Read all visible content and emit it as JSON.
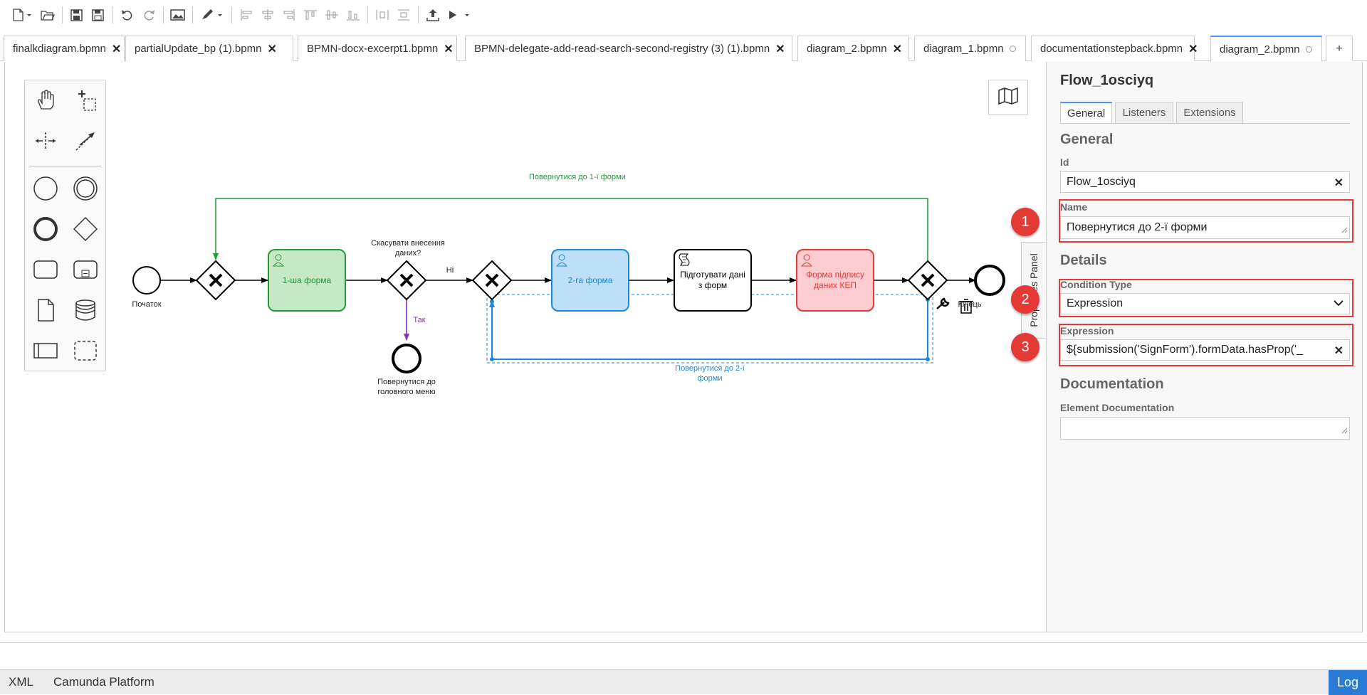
{
  "toolbar": {
    "icons": [
      "new-file-icon",
      "open-file-icon",
      "save-icon",
      "save-as-icon",
      "undo-icon",
      "redo-icon",
      "export-image-icon",
      "color-picker-icon",
      "align-left-icon",
      "align-center-icon",
      "align-right-icon",
      "align-top-icon",
      "align-middle-icon",
      "align-bottom-icon",
      "distribute-horizontal-icon",
      "distribute-vertical-icon",
      "deploy-icon",
      "run-icon"
    ]
  },
  "tabs": [
    {
      "label": "finalkdiagram.bpmn",
      "status": "close"
    },
    {
      "label": "partialUpdate_bp (1).bpmn",
      "status": "close"
    },
    {
      "label": "BPMN-docx-excerpt1.bpmn",
      "status": "close"
    },
    {
      "label": "BPMN-delegate-add-read-search-second-registry (3) (1).bpmn",
      "status": "close"
    },
    {
      "label": "diagram_2.bpmn",
      "status": "close"
    },
    {
      "label": "diagram_1.bpmn",
      "status": "unsaved"
    },
    {
      "label": "documentationstepback.bpmn",
      "status": "close"
    },
    {
      "label": "diagram_2.bpmn",
      "status": "unsaved",
      "active": true
    }
  ],
  "tab_add_label": "+",
  "tab_close_glyph": "✕",
  "diagram": {
    "start_event": "Початок",
    "end_event": "Кінець",
    "gateway_question": "Скасувати внесення даних?",
    "flow_no": "Ні",
    "flow_yes": "Так",
    "return_menu": "Повернутися до головного меню",
    "task_form1": "1-ша форма",
    "task_form2": "2-га форма",
    "task_prepare": "Підготувати дані з форм",
    "task_sign": "Форма підпису даних КЕП",
    "flow_back1": "Повернутися до 1-ї форми",
    "flow_back2": "Повернутися до 2-ї форми",
    "colors": {
      "green": "#1f9a36",
      "green_fill": "#c7e8c4",
      "blue": "#1c88da",
      "blue_fill": "#bde0f8",
      "red": "#e53935",
      "red_fill": "#fcccd0",
      "purple": "#8e2cbf"
    }
  },
  "properties": {
    "toggle_label": "Properties Panel",
    "title": "Flow_1osciyq",
    "tabs": [
      "General",
      "Listeners",
      "Extensions"
    ],
    "sections": {
      "general": "General",
      "details": "Details",
      "documentation": "Documentation"
    },
    "id_label": "Id",
    "id_value": "Flow_1osciyq",
    "name_label": "Name",
    "name_value": "Повернутися до 2-ї форми",
    "condition_type_label": "Condition Type",
    "condition_type_value": "Expression",
    "expression_label": "Expression",
    "expression_value": "${submission('SignForm').formData.hasProp('_",
    "doc_label": "Element Documentation",
    "doc_value": "",
    "clear_glyph": "✕"
  },
  "annotations": [
    "1",
    "2",
    "3"
  ],
  "statusbar": {
    "xml": "XML",
    "platform": "Camunda Platform",
    "log": "Log"
  }
}
